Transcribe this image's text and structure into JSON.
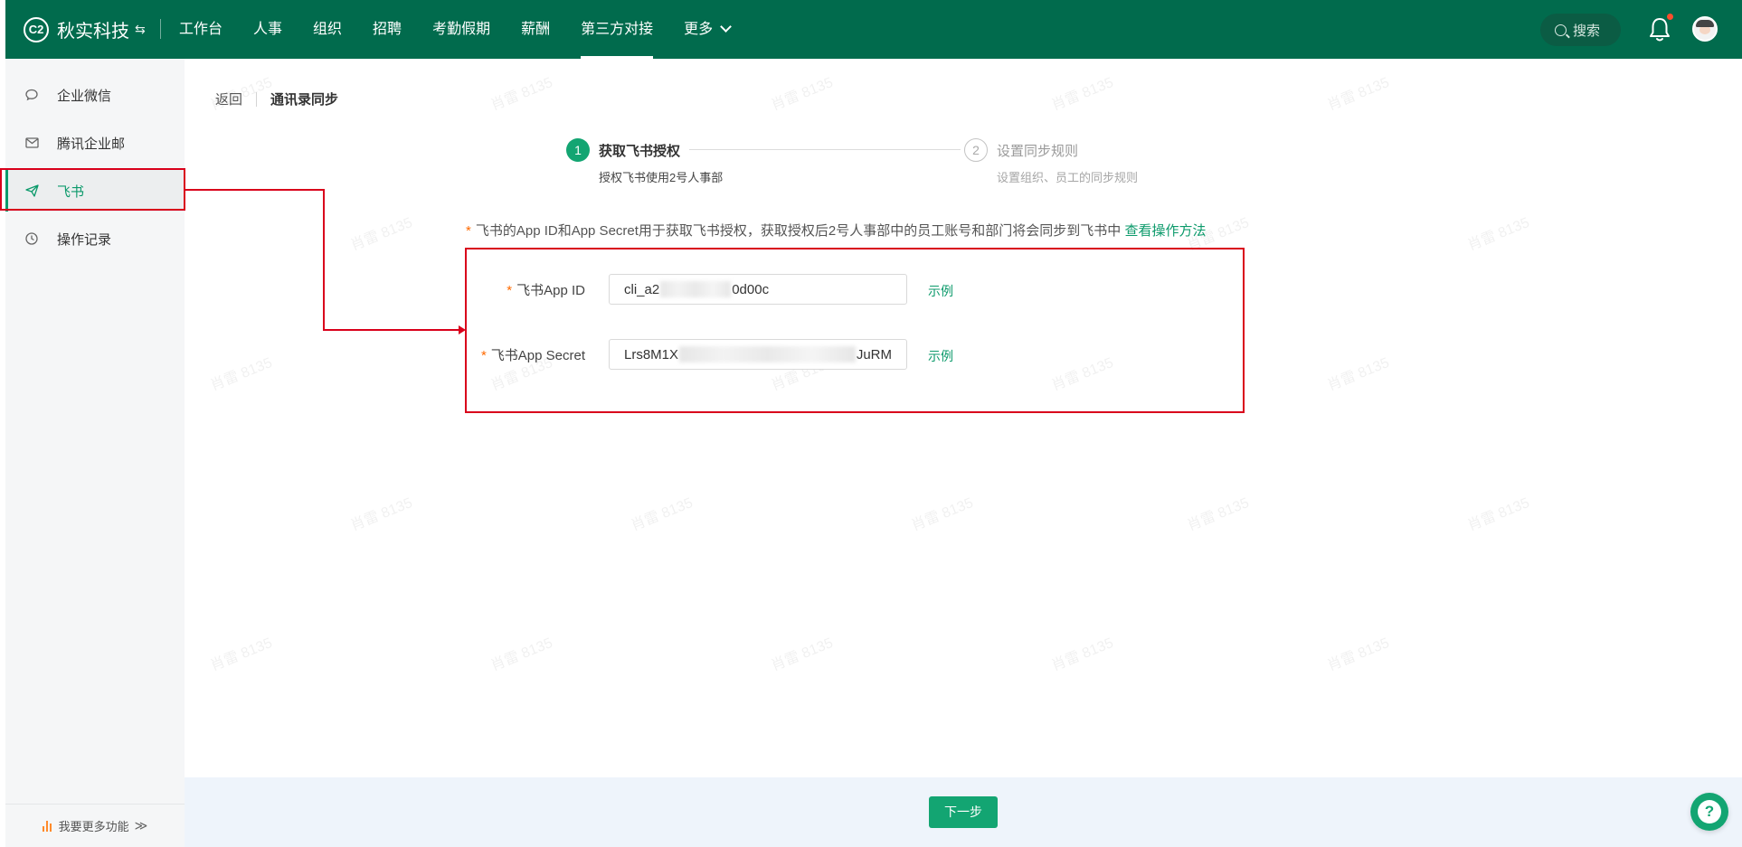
{
  "app": {
    "brand_logo": "C2",
    "brand_name": "秋实科技",
    "brand_switch_icon": "⇆"
  },
  "top_nav": {
    "items": [
      "工作台",
      "人事",
      "组织",
      "招聘",
      "考勤假期",
      "薪酬",
      "第三方对接",
      "更多"
    ],
    "active": "第三方对接",
    "search_placeholder": "搜索",
    "notification_badge": true
  },
  "sidebar": {
    "items": [
      {
        "label": "企业微信",
        "icon": "wecom-icon"
      },
      {
        "label": "腾讯企业邮",
        "icon": "mail-icon"
      },
      {
        "label": "飞书",
        "icon": "send-icon"
      },
      {
        "label": "操作记录",
        "icon": "clock-icon"
      }
    ],
    "active": "飞书",
    "footer_label": "我要更多功能",
    "footer_chevron": "≫"
  },
  "breadcrumb": {
    "back": "返回",
    "current": "通讯录同步"
  },
  "steps": [
    {
      "number": "1",
      "title": "获取飞书授权",
      "desc": "授权飞书使用2号人事部",
      "state": "active"
    },
    {
      "number": "2",
      "title": "设置同步规则",
      "desc": "设置组织、员工的同步规则",
      "state": "pending"
    }
  ],
  "notice": {
    "asterisk": "*",
    "text": "飞书的App ID和App Secret用于获取飞书授权，获取授权后2号人事部中的员工账号和部门将会同步到飞书中",
    "link": "查看操作方法"
  },
  "form": {
    "required_mark": "*",
    "app_id_label": "飞书App ID",
    "app_id_prefix": "cli_a2",
    "app_id_suffix": "0d00c",
    "app_secret_label": "飞书App Secret",
    "app_secret_prefix": "Lrs8M1X",
    "app_secret_suffix": "JuRM",
    "example_link": "示例"
  },
  "footer": {
    "next_button": "下一步",
    "help_glyph": "?"
  },
  "watermark_text": "肖雷 8135",
  "colors": {
    "topbar": "#016b4d",
    "accent": "#13a572",
    "annotation": "#d9001b",
    "required": "#ff6a00"
  }
}
